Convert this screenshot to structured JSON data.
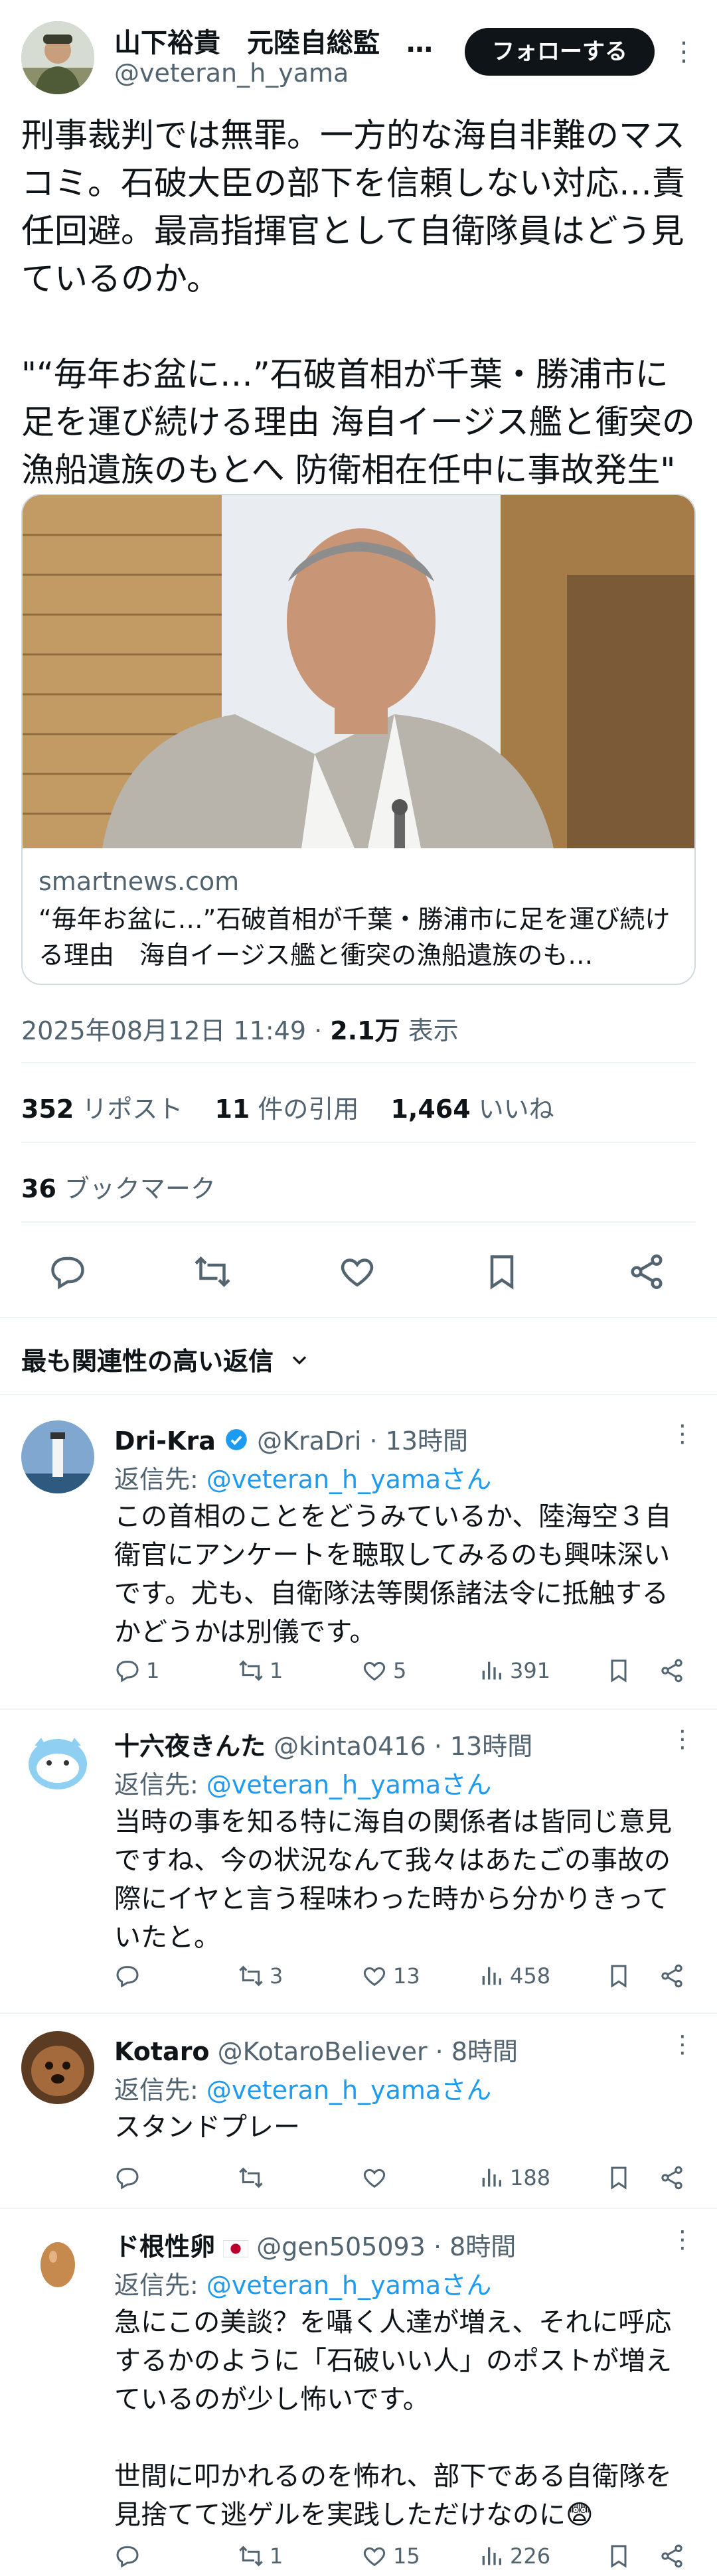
{
  "post": {
    "author_name": "山下裕貴　元陸自総監　…",
    "author_handle": "@veteran_h_yama",
    "follow_label": "フォローする",
    "more": "⋮",
    "text": "刑事裁判では無罪。一方的な海自非難のマスコミ。石破大臣の部下を信頼しない対応…責任回避。最高指揮官として自衛隊員はどう見ているのか。\n\n\"“毎年お盆に…”石破首相が千葉・勝浦市に足を運び続ける理由 海自イージス艦と衝突の漁船遺族のもとへ 防衛相在任中に事故発生\"",
    "card": {
      "domain": "smartnews.com",
      "title": "“毎年お盆に…”石破首相が千葉・勝浦市に足を運び続ける理由　海自イージス艦と衝突の漁船遺族のも…"
    },
    "timestamp": "2025年08月12日 11:49",
    "sep": "·",
    "views": "2.1万",
    "views_label": "表示",
    "reposts": "352",
    "reposts_label": "リポスト",
    "quotes": "11",
    "quotes_label": "件の引用",
    "likes": "1,464",
    "likes_label": "いいね",
    "bookmarks": "36",
    "bookmarks_label": "ブックマーク"
  },
  "relevant_label": "最も関連性の高い返信",
  "reply_to_label": "返信先: ",
  "reply_to_handle": "@veteran_h_yamaさん",
  "replies": [
    {
      "name": "Dri-Kra",
      "handle": "@KraDri",
      "time": "· 13時間",
      "text": "この首相のことをどうみているか、陸海空３自衛官にアンケートを聴取してみるのも興味深いです。尤も、自衛隊法等関係諸法令に抵触するかどうかは別儀です。",
      "reply_count": "1",
      "repost_count": "1",
      "like_count": "5",
      "view_count": "391"
    },
    {
      "name": "十六夜きんた",
      "handle": "@kinta0416",
      "time": "· 13時間",
      "text": "当時の事を知る特に海自の関係者は皆同じ意見ですね、今の状況なんて我々はあたごの事故の際にイヤと言う程味わった時から分かりきっていたと。",
      "reply_count": "",
      "repost_count": "3",
      "like_count": "13",
      "view_count": "458"
    },
    {
      "name": "Kotaro",
      "handle": "@KotaroBeliever",
      "time": "· 8時間",
      "text": "スタンドプレー",
      "reply_count": "",
      "repost_count": "",
      "like_count": "",
      "view_count": "188"
    },
    {
      "name": "ド根性卵",
      "handle": "@gen505093",
      "time": "· 8時間",
      "text": "急にこの美談？を囁く人達が増え、それに呼応するかのように「石破いい人」のポストが増えているのが少し怖いです。\n\n世間に叩かれるのを怖れ、部下である自衛隊を見捨てて逃ゲルを実践しただけなのに😨",
      "reply_count": "",
      "repost_count": "1",
      "like_count": "15",
      "view_count": "226"
    }
  ],
  "colors": {
    "text": "#0f1419",
    "secondary": "#536471",
    "link": "#1d9bf0",
    "verified": "#1d9bf0",
    "border": "#eff3f4"
  }
}
